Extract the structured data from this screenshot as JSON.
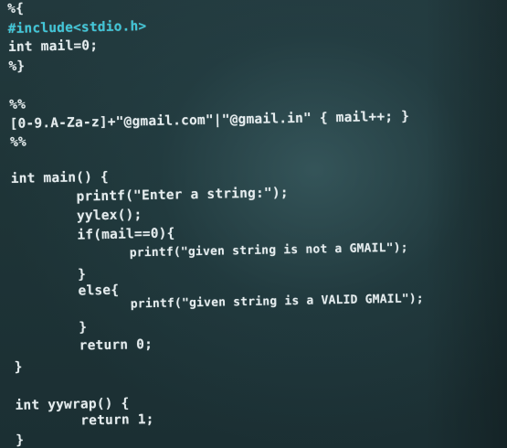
{
  "editor": {
    "lines": [
      "%{",
      "#include<stdio.h>",
      "int mail=0;",
      "%}",
      "%%",
      "[0-9.A-Za-z]+\"@gmail.com\"|\"@gmail.in\" { mail++; }",
      "%%",
      "int main() {",
      "        printf(\"Enter a string:\");",
      "        yylex();",
      "        if(mail==0){",
      "                printf(\"given string is not a GMAIL\");",
      "        }",
      "        else{",
      "                printf(\"given string is a VALID GMAIL\");",
      "        }",
      "        return 0;",
      "}",
      "int yywrap() {",
      "        return 1;",
      "}"
    ]
  }
}
